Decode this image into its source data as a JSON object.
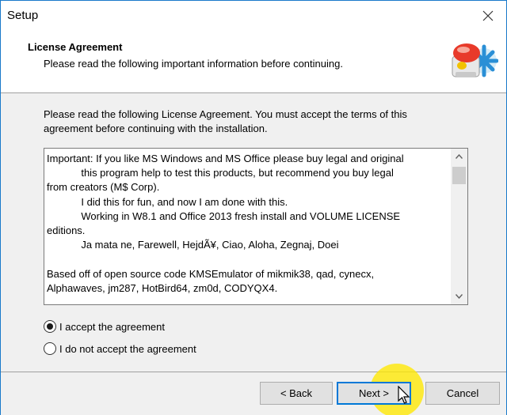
{
  "window": {
    "title": "Setup"
  },
  "header": {
    "title": "License Agreement",
    "subtitle": "Please read the following important information before continuing."
  },
  "intro": {
    "line1": "Please read the following License Agreement. You must accept the terms of this",
    "line2": "agreement before continuing with the installation."
  },
  "license": {
    "text": "Important: If you like MS Windows and MS Office please buy legal and original\n            this program help to test this products, but recommend you buy legal\nfrom creators (M$ Corp).\n            I did this for fun, and now I am done with this.\n            Working in W8.1 and Office 2013 fresh install and VOLUME LICENSE\neditions.\n            Ja mata ne, Farewell, HejdÃ¥, Ciao, Aloha, Zegnaj, Doei\n\nBased off of open source code KMSEmulator of mikmik38, qad, cynecx,\nAlphawaves, jm287, HotBird64, zm0d, CODYQX4."
  },
  "options": {
    "accept": "I accept the agreement",
    "decline": "I do not accept the agreement",
    "selected": "accept"
  },
  "buttons": {
    "back": "< Back",
    "next": "Next >",
    "cancel": "Cancel"
  },
  "colors": {
    "window_border": "#1979ca",
    "focus_border": "#0078d7",
    "click_highlight": "#ffe800"
  },
  "icons": {
    "close": "close-icon",
    "logo": "setup-logo-icon",
    "scroll_up": "chevron-up-icon",
    "scroll_down": "chevron-down-icon",
    "cursor": "mouse-pointer-icon"
  }
}
